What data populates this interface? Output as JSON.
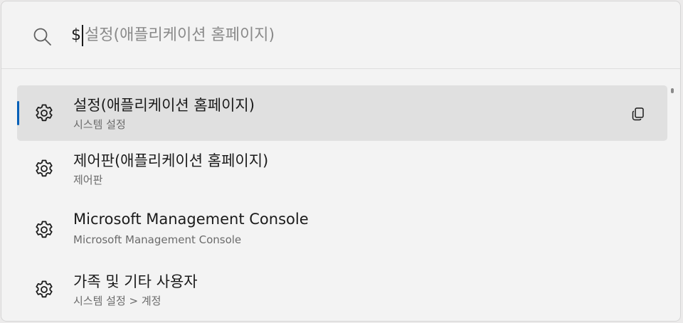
{
  "search": {
    "query": "$",
    "placeholder": "설정(애플리케이션 홈페이지)"
  },
  "results": [
    {
      "title": "설정(애플리케이션 홈페이지)",
      "subtitle": "시스템 설정",
      "icon": "gear-icon",
      "selected": true,
      "action_icon": "copy-icon"
    },
    {
      "title": "제어판(애플리케이션 홈페이지)",
      "subtitle": "제어판",
      "icon": "gear-icon",
      "selected": false
    },
    {
      "title": "Microsoft Management Console",
      "subtitle": "Microsoft Management Console",
      "icon": "gear-icon",
      "selected": false
    },
    {
      "title": "가족 및 기타 사용자",
      "subtitle": "시스템 설정  >  계정",
      "icon": "gear-icon",
      "selected": false
    }
  ],
  "colors": {
    "accent": "#005fb8",
    "selected_background": "#e0e0e0",
    "window_background": "#f3f3f3"
  }
}
